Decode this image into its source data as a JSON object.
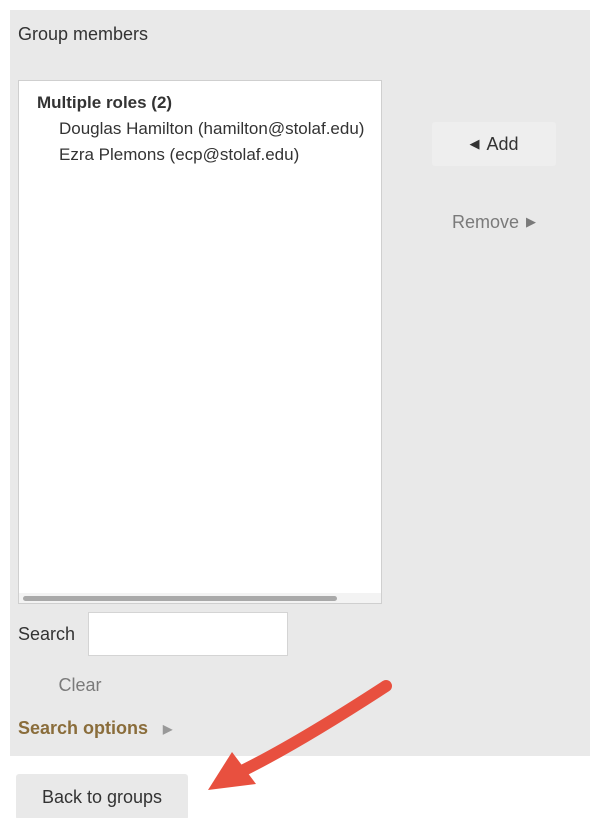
{
  "panel": {
    "title": "Group members"
  },
  "members_list": {
    "group_label": "Multiple roles (2)",
    "options": [
      "Douglas Hamilton (hamilton@stolaf.edu)",
      "Ezra Plemons (ecp@stolaf.edu)"
    ]
  },
  "actions": {
    "add_label": "Add",
    "add_arrow": "◀",
    "remove_label": "Remove",
    "remove_arrow": "▶"
  },
  "search": {
    "label": "Search",
    "value": "",
    "placeholder": "",
    "clear_label": "Clear",
    "options_label": "Search options",
    "options_caret": "▶"
  },
  "footer": {
    "back_label": "Back to groups"
  },
  "annotation": {
    "arrow_color": "#e8503f"
  }
}
